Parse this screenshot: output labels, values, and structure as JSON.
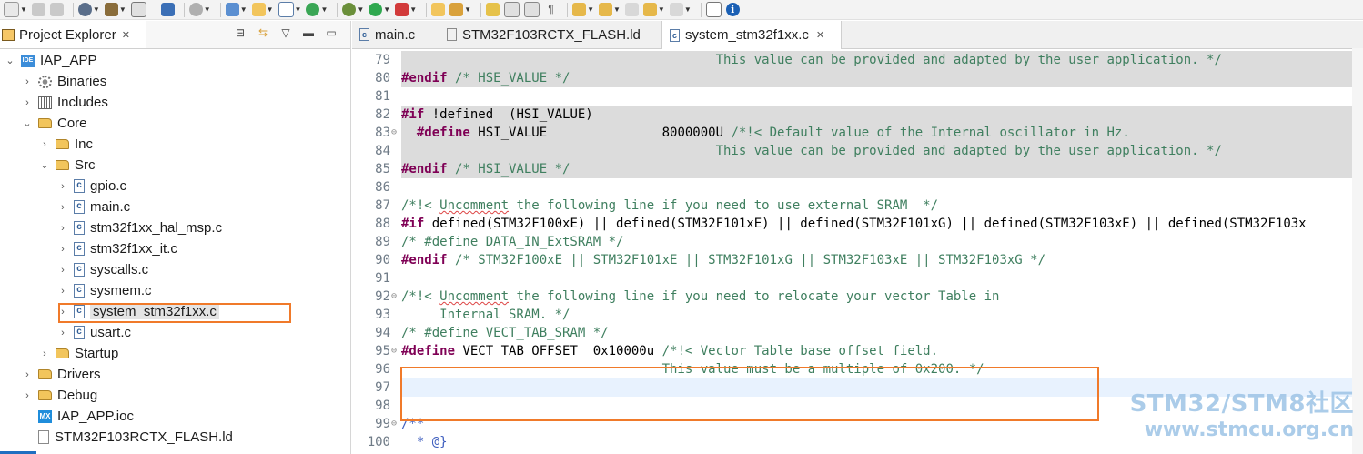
{
  "toolbar": {
    "icons": [
      "new-icon",
      "save-icon",
      "save-all-icon",
      "settings-gear-icon",
      "build-hammer-icon",
      "binary-icon",
      "debug-icon",
      "tools-icon",
      "new-class-icon",
      "new-folder-icon",
      "new-c-file-icon",
      "refresh-icon",
      "debug-bug-icon",
      "run-icon",
      "stop-icon",
      "open-type-icon",
      "search-icon",
      "mark-icon",
      "toggle-icon",
      "toggle-2-icon",
      "whitespace-icon",
      "next-annotation-icon",
      "prev-annotation-icon",
      "back-icon",
      "back-2-icon",
      "forward-icon",
      "pin-icon",
      "info-icon"
    ]
  },
  "project_explorer": {
    "title": "Project Explorer",
    "tree": [
      {
        "label": "IAP_APP",
        "icon": "project-icon",
        "expanded": true
      },
      {
        "label": "Binaries",
        "icon": "binaries-icon"
      },
      {
        "label": "Includes",
        "icon": "includes-icon"
      },
      {
        "label": "Core",
        "icon": "folder-icon",
        "expanded": true
      },
      {
        "label": "Inc",
        "icon": "folder-icon"
      },
      {
        "label": "Src",
        "icon": "folder-icon",
        "expanded": true
      },
      {
        "label": "gpio.c",
        "icon": "c-file-icon"
      },
      {
        "label": "main.c",
        "icon": "c-file-icon"
      },
      {
        "label": "stm32f1xx_hal_msp.c",
        "icon": "c-file-icon"
      },
      {
        "label": "stm32f1xx_it.c",
        "icon": "c-file-icon"
      },
      {
        "label": "syscalls.c",
        "icon": "c-file-icon"
      },
      {
        "label": "sysmem.c",
        "icon": "c-file-icon"
      },
      {
        "label": "system_stm32f1xx.c",
        "icon": "c-file-icon",
        "selected": true
      },
      {
        "label": "usart.c",
        "icon": "c-file-icon"
      },
      {
        "label": "Startup",
        "icon": "folder-icon"
      },
      {
        "label": "Drivers",
        "icon": "folder-icon"
      },
      {
        "label": "Debug",
        "icon": "folder-icon"
      },
      {
        "label": "IAP_APP.ioc",
        "icon": "mx-file-icon"
      },
      {
        "label": "STM32F103RCTX_FLASH.ld",
        "icon": "ld-file-icon"
      }
    ]
  },
  "editor": {
    "tabs": [
      {
        "label": "main.c"
      },
      {
        "label": "STM32F103RCTX_FLASH.ld"
      },
      {
        "label": "system_stm32f1xx.c",
        "active": true
      }
    ],
    "lines": [
      {
        "n": "79",
        "text": "                                         This value can be provided and adapted by the user application. */"
      },
      {
        "n": "80",
        "text": "#endif /* HSE_VALUE */"
      },
      {
        "n": "81",
        "text": ""
      },
      {
        "n": "82",
        "text": "#if !defined  (HSI_VALUE)"
      },
      {
        "n": "83",
        "text": "  #define HSI_VALUE               8000000U /*!< Default value of the Internal oscillator in Hz."
      },
      {
        "n": "84",
        "text": "                                         This value can be provided and adapted by the user application. */"
      },
      {
        "n": "85",
        "text": "#endif /* HSI_VALUE */"
      },
      {
        "n": "86",
        "text": ""
      },
      {
        "n": "87",
        "text": "/*!< Uncomment the following line if you need to use external SRAM  */"
      },
      {
        "n": "88",
        "text": "#if defined(STM32F100xE) || defined(STM32F101xE) || defined(STM32F101xG) || defined(STM32F103xE) || defined(STM32F103x"
      },
      {
        "n": "89",
        "text": "/* #define DATA_IN_ExtSRAM */"
      },
      {
        "n": "90",
        "text": "#endif /* STM32F100xE || STM32F101xE || STM32F101xG || STM32F103xE || STM32F103xG */"
      },
      {
        "n": "91",
        "text": ""
      },
      {
        "n": "92",
        "text": "/*!< Uncomment the following line if you need to relocate your vector Table in"
      },
      {
        "n": "93",
        "text": "     Internal SRAM. */"
      },
      {
        "n": "94",
        "text": "/* #define VECT_TAB_SRAM */"
      },
      {
        "n": "95",
        "text": "#define VECT_TAB_OFFSET  0x10000u /*!< Vector Table base offset field."
      },
      {
        "n": "96",
        "text": "                                  This value must be a multiple of 0x200. */"
      },
      {
        "n": "97",
        "text": ""
      },
      {
        "n": "98",
        "text": ""
      },
      {
        "n": "99",
        "text": "/**"
      },
      {
        "n": "100",
        "text": "  * @}"
      }
    ]
  },
  "watermark": {
    "line1": "STM32/STM8社区",
    "line2": "www.stmcu.org.cn"
  }
}
